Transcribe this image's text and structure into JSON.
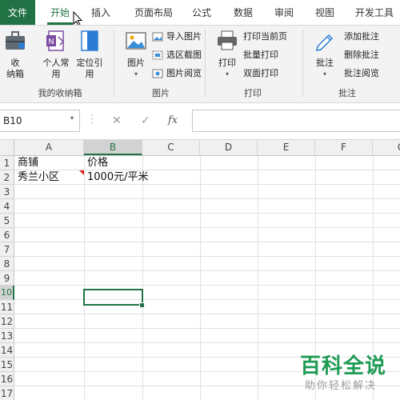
{
  "tabs": {
    "file": "文件",
    "items": [
      "开始",
      "插入",
      "页面布局",
      "公式",
      "数据",
      "审阅",
      "视图",
      "开发工具"
    ],
    "active_index": 0
  },
  "ribbon": {
    "group_storage": {
      "label": "我的收纳箱",
      "receive_box": "收\n纳箱",
      "personal": "个人常\n用",
      "locate": "定位引\n用"
    },
    "group_picture": {
      "label": "图片",
      "picture": "图片",
      "import": "导入图片",
      "screenshot": "选区截图",
      "browse": "图片阅览"
    },
    "group_print": {
      "label": "打印",
      "print": "打印",
      "print_current": "打印当前页",
      "batch_print": "批量打印",
      "duplex_print": "双面打印"
    },
    "group_comment": {
      "label": "批注",
      "comment": "批注",
      "add": "添加批注",
      "delete": "删除批注",
      "browse": "批注阅览"
    }
  },
  "formula_bar": {
    "name_box": "B10",
    "fx_symbol": "fx",
    "formula_value": ""
  },
  "sheet": {
    "columns": [
      "A",
      "B",
      "C",
      "D",
      "E",
      "F",
      "G"
    ],
    "rows": [
      "1",
      "2",
      "3",
      "4",
      "5",
      "6",
      "7",
      "8",
      "9",
      "10",
      "11",
      "12",
      "13",
      "14",
      "15",
      "16",
      "17"
    ],
    "cells": {
      "A1": "商铺",
      "B1": "价格",
      "A2": "秀兰小区",
      "B2": "1000元/平米"
    },
    "selected_cell": "B10",
    "selected_column": "B",
    "selected_row": "10"
  },
  "watermark": {
    "title": "百科全说",
    "subtitle": "助你轻松解决"
  },
  "colors": {
    "accent": "#217346",
    "comment_marker": "#e0201a",
    "watermark_green": "#1e9b54"
  }
}
